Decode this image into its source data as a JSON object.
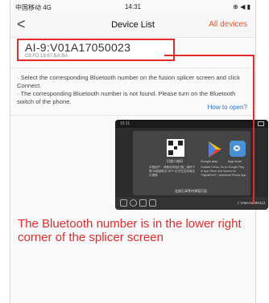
{
  "status": {
    "carrier": "中国移动",
    "network": "4G",
    "time": "14:31",
    "right": "⊕ ◀ ▮"
  },
  "nav": {
    "back": "<",
    "title": "Device List",
    "right_link": "All devices"
  },
  "device": {
    "name": "AI-9:V01A17050023",
    "mac": "C8:FD:19:67:BA:BA"
  },
  "info": {
    "line1": "· Select the corresponding Bluetooth number on the fusion splicer screen and click Connect.",
    "line2": "· The corresponding Bluetooth number is not found. Please turn on the Bluetooth switch of the phone.",
    "how_to_open": "How to open?"
  },
  "tablet": {
    "time": "15:11",
    "qr_label": "扫描二维码",
    "google_label": "Google play",
    "appstore_label": "App store",
    "cn_text": "中国用户：请使用电脑扫描二维码下载“AI熔接助手”APP 也可在应用商店中搜索",
    "en_text": "Outside China: Go to Google Play or App Store and search for “SignalFire2”, download Phone App",
    "bottom_note": "连接后请等待弹窗页面",
    "bt_id": "V08A15090113"
  },
  "instruction": "The Bluetooth number is in the lower right corner of the splicer screen",
  "colors": {
    "accent": "#e32b2b",
    "link": "#2f76c8",
    "nav_link": "#e8562a"
  }
}
